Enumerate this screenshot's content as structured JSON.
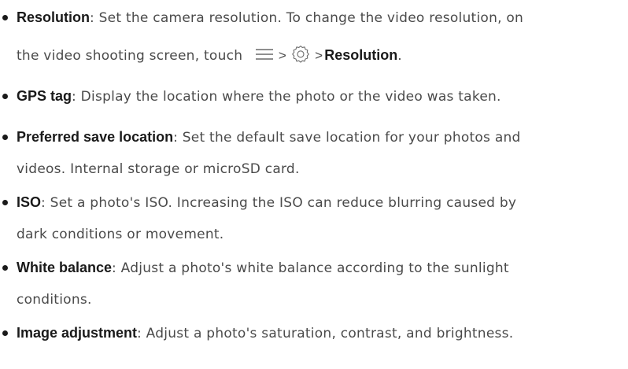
{
  "items": [
    {
      "term": "Resolution",
      "line1": ": Set the camera resolution. To change the video resolution, on",
      "line2_prefix": "the video shooting screen, touch",
      "gt1": ">",
      "gt2": ">",
      "menu_icon": "menu-icon",
      "settings_icon": "settings-gear-icon",
      "path_term": "Resolution",
      "line2_suffix": "."
    },
    {
      "term": "GPS tag",
      "line1": ": Display the location where the photo or the video was taken."
    },
    {
      "term": "Preferred save location",
      "line1": ": Set the default save location for your photos and",
      "line2": "videos. Internal storage or microSD card."
    },
    {
      "term": "ISO",
      "line1": ": Set a photo's ISO. Increasing the ISO can reduce blurring caused by",
      "line2": "dark conditions or movement."
    },
    {
      "term": "White balance",
      "line1": ": Adjust a photo's white balance according to the sunlight",
      "line2": "conditions."
    },
    {
      "term": "Image adjustment",
      "line1": ": Adjust a photo's saturation, contrast, and brightness."
    }
  ]
}
